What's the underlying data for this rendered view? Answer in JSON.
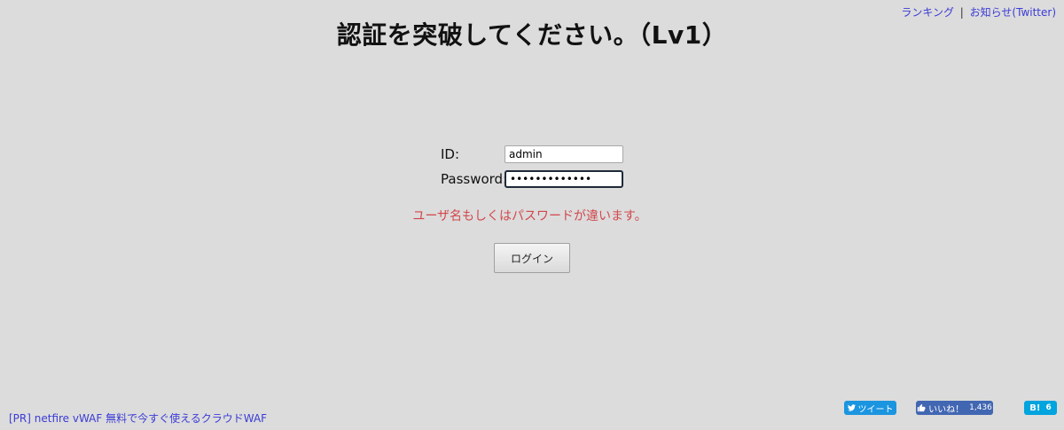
{
  "header": {
    "ranking_link": "ランキング",
    "separator": "|",
    "news_link": "お知らせ(Twitter)"
  },
  "page": {
    "title": "認証を突破してください。（Lv1）"
  },
  "login_form": {
    "id_label": "ID:",
    "id_value": "admin",
    "password_label": "Password:",
    "password_value": "•••••••••••••",
    "error_message": "ユーザ名もしくはパスワードが違います。",
    "login_button": "ログイン"
  },
  "footer": {
    "pr_link": "[PR] netfire vWAF 無料で今すぐ使えるクラウドWAF",
    "tweet_button": "ツイート",
    "like_button": "いいね！",
    "like_count": "1,436",
    "hatena_label": "B!",
    "hatena_count": "6"
  },
  "colors": {
    "background": "#dcdcdc",
    "link": "#3b3bd6",
    "error": "#d2474c",
    "twitter": "#1b95e0",
    "facebook": "#4267b2",
    "hatena": "#00a4de"
  }
}
